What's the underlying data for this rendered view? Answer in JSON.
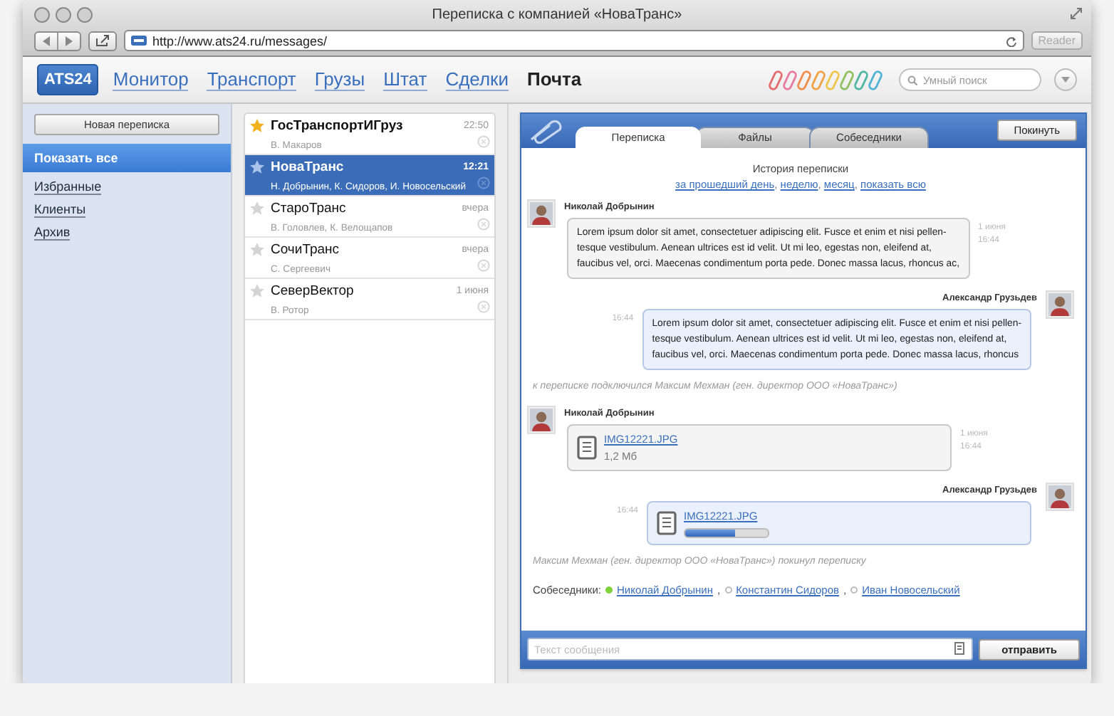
{
  "window": {
    "title": "Переписка с компанией «НоваТранс»"
  },
  "browser": {
    "url": "http://www.ats24.ru/messages/",
    "reader": "Reader"
  },
  "nav": {
    "logo": "ATS24",
    "items": [
      {
        "label": "Монитор",
        "selected": false
      },
      {
        "label": "Транспорт",
        "selected": false
      },
      {
        "label": "Грузы",
        "selected": false
      },
      {
        "label": "Штат",
        "selected": false
      },
      {
        "label": "Сделки",
        "selected": false
      },
      {
        "label": "Почта",
        "selected": true
      }
    ],
    "search": {
      "placeholder": "Умный поиск"
    }
  },
  "sidebar": {
    "new_button": "Новая переписка",
    "items": [
      {
        "label": "Показать все",
        "selected": true
      },
      {
        "label": "Избранные",
        "selected": false
      },
      {
        "label": "Клиенты",
        "selected": false
      },
      {
        "label": "Архив",
        "selected": false
      }
    ]
  },
  "conversations": [
    {
      "name": "ГосТранспортИГруз",
      "people": "В. Макаров",
      "time": "22:50",
      "starred": true,
      "selected": false
    },
    {
      "name": "НоваТранс",
      "people": "Н. Добрынин, К. Сидоров, И. Новосельский",
      "time": "12:21",
      "starred": false,
      "selected": true
    },
    {
      "name": "СтароТранс",
      "people": "В. Головлев, К. Велощапов",
      "time": "вчера",
      "starred": false,
      "selected": false
    },
    {
      "name": "СочиТранс",
      "people": "С. Сергеевич",
      "time": "вчера",
      "starred": false,
      "selected": false
    },
    {
      "name": "СеверВектор",
      "people": "В. Ротор",
      "time": "1 июня",
      "starred": false,
      "selected": false
    }
  ],
  "chat": {
    "tabs": [
      {
        "label": "Переписка",
        "selected": true
      },
      {
        "label": "Файлы",
        "selected": false
      },
      {
        "label": "Собеседники",
        "selected": false
      }
    ],
    "leave_button": "Покинуть",
    "history": {
      "title": "История переписки",
      "separator": ",",
      "links": [
        "за прошедший день",
        "неделю",
        "месяц",
        "показать всю"
      ]
    },
    "messages": [
      {
        "kind": "text",
        "outgoing": false,
        "author": "Николай Добрынин",
        "date": "1 июня",
        "time": "16:44",
        "lines": [
          "Lorem ipsum dolor sit amet, consectetuer adipiscing elit. Fusce et enim et nisi pellen-",
          "tesque vestibulum. Aenean ultrices est id velit. Ut mi leo, egestas non, eleifend at,",
          "faucibus vel, orci. Maecenas condimentum porta pede. Donec massa lacus, rhoncus ac,"
        ]
      },
      {
        "kind": "text",
        "outgoing": true,
        "author": "Александр Грузьдев",
        "time": "16:44",
        "lines": [
          "Lorem ipsum dolor sit amet, consectetuer adipiscing elit. Fusce et enim et nisi pellen-",
          "tesque vestibulum. Aenean ultrices est id velit. Ut mi leo, egestas non, eleifend at,",
          "faucibus vel, orci. Maecenas condimentum porta pede. Donec massa lacus, rhoncus"
        ]
      },
      {
        "kind": "system",
        "text": "к переписке подключился Максим Мехман (ген. директор ООО «НоваТранс»)"
      },
      {
        "kind": "file",
        "outgoing": false,
        "author": "Николай Добрынин",
        "date": "1 июня",
        "time": "16:44",
        "file": "IMG12221.JPG",
        "size": "1,2 Мб"
      },
      {
        "kind": "upload",
        "outgoing": true,
        "author": "Александр Грузьдев",
        "time": "16:44",
        "file": "IMG12221.JPG",
        "level": 0.6
      },
      {
        "kind": "system",
        "text": "Максим Мехман (ген. директор ООО «НоваТранс») покинул переписку"
      }
    ],
    "participants_label": "Собеседники:",
    "participants_separator": ",",
    "participants": [
      {
        "name": "Николай Добрынин",
        "online": true
      },
      {
        "name": "Константин Сидоров",
        "online": false
      },
      {
        "name": "Иван Новосельский",
        "online": false
      }
    ],
    "composer": {
      "placeholder": "Текст сообщения",
      "send_button": "отправить"
    }
  }
}
